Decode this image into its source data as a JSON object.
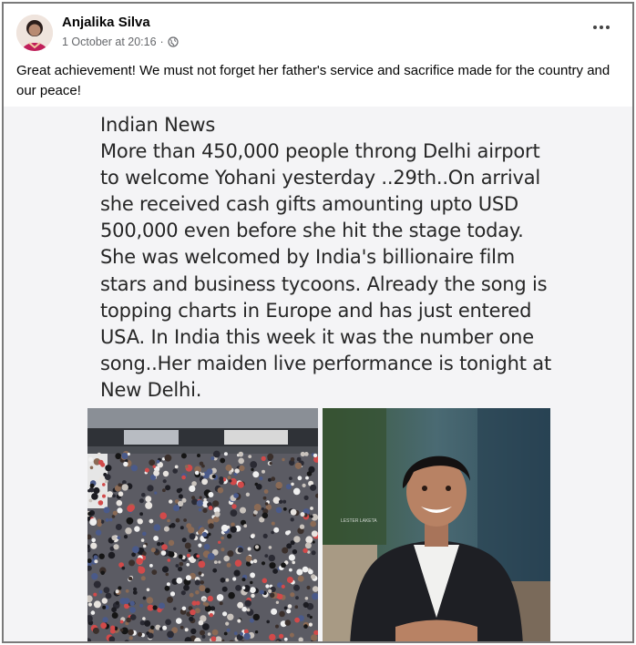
{
  "post": {
    "author": "Anjalika Silva",
    "timestamp": "1 October at 20:16",
    "separator": "·",
    "caption": "Great achievement!  We must not forget her father's service and sacrifice made for the country and our peace!",
    "shared_text": {
      "heading": "Indian News",
      "body": "More than 450,000 people throng Delhi airport to welcome Yohani yesterday ..29th..On arrival she received  cash gifts amounting upto USD 500,000 even before she hit the stage today. She was welcomed by India's billionaire film stars and business tycoons.  Already the song is topping charts in Europe and has just entered USA. In India this week it was the number one song..Her maiden live performance is tonight at New Delhi."
    },
    "images": [
      {
        "name": "crowd-photo"
      },
      {
        "name": "portrait-photo"
      }
    ]
  },
  "icons": {
    "privacy": "globe-icon",
    "options": "more-options-icon"
  },
  "colors": {
    "text": "#050505",
    "meta": "#65676b",
    "border": "#7a7a7a",
    "media_bg": "#f4f4f6"
  }
}
